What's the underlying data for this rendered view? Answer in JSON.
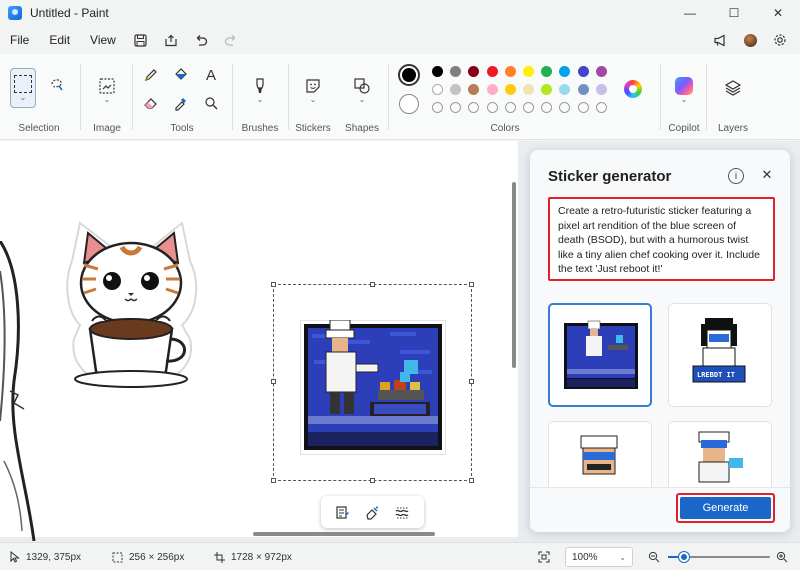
{
  "window": {
    "title": "Untitled - Paint",
    "minimize": "—",
    "maximize": "☐",
    "close": "✕"
  },
  "menu": {
    "file": "File",
    "edit": "Edit",
    "view": "View"
  },
  "ribbon": {
    "groups": {
      "selection": "Selection",
      "image": "Image",
      "tools": "Tools",
      "brushes": "Brushes",
      "stickers": "Stickers",
      "shapes": "Shapes",
      "colors": "Colors",
      "copilot": "Copilot",
      "layers": "Layers"
    },
    "text_tool_glyph": "A",
    "primary_color": "#000000",
    "secondary_color": "#ffffff",
    "palette_row1": [
      "#000000",
      "#7f7f7f",
      "#880015",
      "#ed1c24",
      "#ff7f27",
      "#fff200",
      "#22b14c",
      "#00a2e8",
      "#3f48cc",
      "#a349a4"
    ],
    "palette_row2": [
      "#ffffff",
      "#c3c3c3",
      "#b97a57",
      "#ffaec9",
      "#ffc90e",
      "#efe4b0",
      "#b5e61d",
      "#99d9ea",
      "#7092be",
      "#c8bfe7"
    ]
  },
  "sticker_panel": {
    "title": "Sticker generator",
    "info_icon": "i",
    "close_icon": "✕",
    "prompt": "Create a retro-futuristic sticker featuring a pixel art rendition of the blue screen of death (BSOD), but with a humorous twist like a tiny alien chef cooking over it. Include the text 'Just reboot it!'",
    "generate_label": "Generate",
    "thumb_text": "LREBDT IT"
  },
  "status": {
    "cursor_pos": "1329, 375px",
    "selection_size": "256 × 256px",
    "canvas_size": "1728 × 972px",
    "zoom": "100%",
    "zoom_level": 0.16
  }
}
